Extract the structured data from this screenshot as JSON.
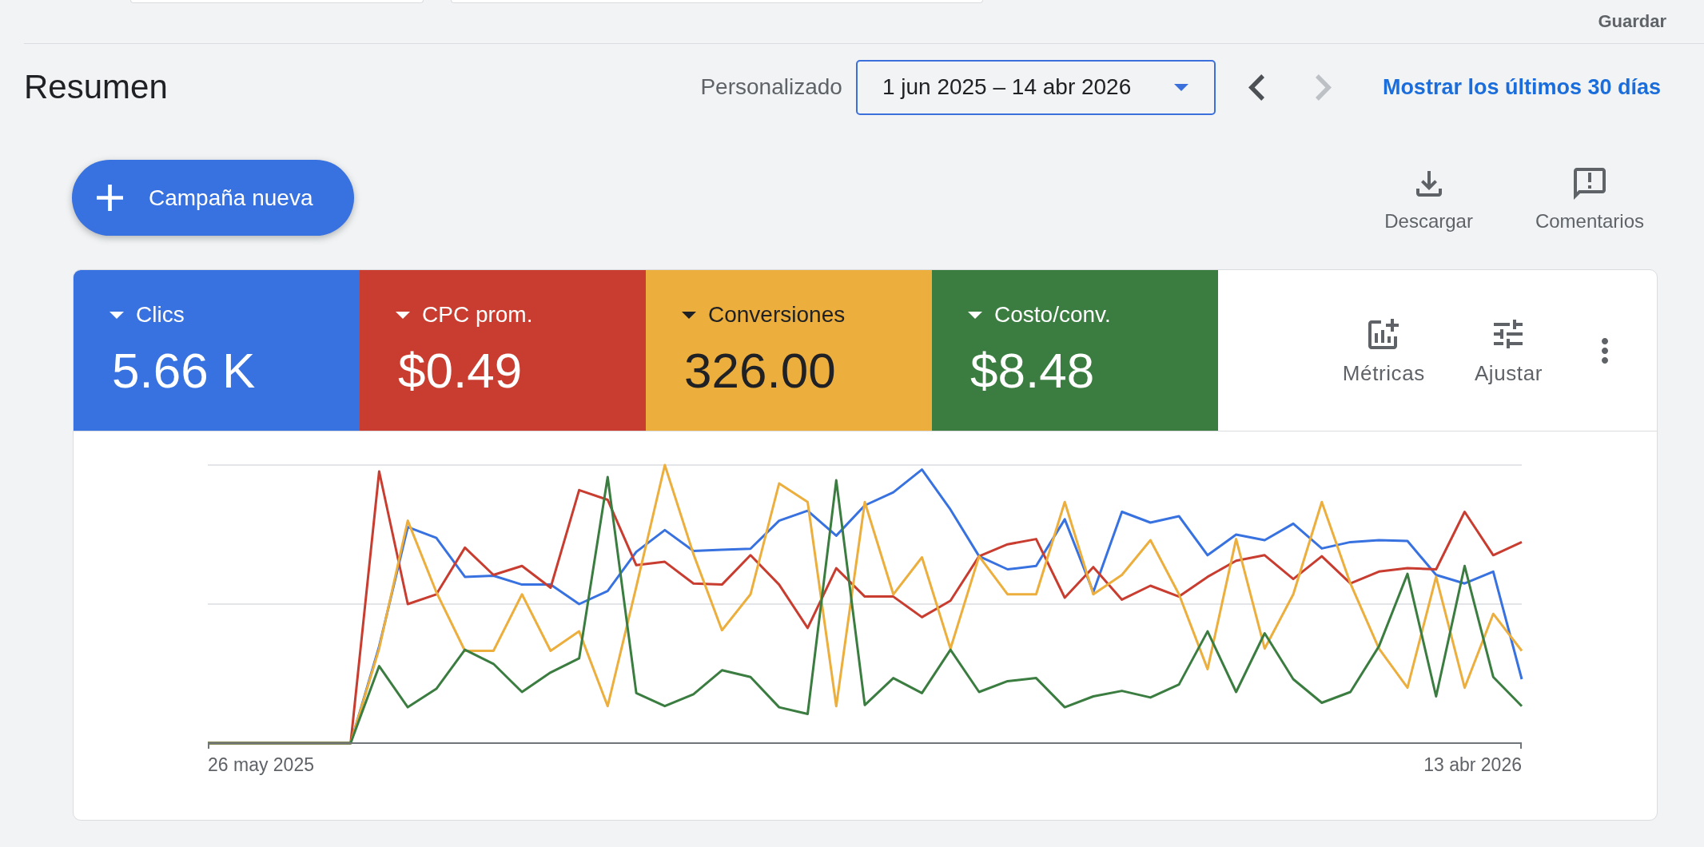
{
  "toolbar": {
    "save_link": "Guardar"
  },
  "header": {
    "title": "Resumen",
    "range_label": "Personalizado",
    "date_range": "1 jun 2025 – 14 abr 2026",
    "previous": {
      "disabled": false
    },
    "next": {
      "disabled": true
    },
    "last_30_days_link": "Mostrar los últimos 30 días"
  },
  "actions": {
    "new_campaign_button": "Campaña nueva",
    "buttons": [
      {
        "kind": "download",
        "label": "Descargar"
      },
      {
        "kind": "feedback",
        "label": "Comentarios"
      }
    ]
  },
  "metrics": [
    {
      "label": "Clics",
      "value": "5.66 K",
      "color": "#3871e0",
      "selected": true
    },
    {
      "label": "CPC prom.",
      "value": "$0.49",
      "color": "#c83d30",
      "selected": true
    },
    {
      "label": "Conversiones",
      "value": "326.00",
      "color": "#ecae3c",
      "selected": true
    },
    {
      "label": "Costo/conv.",
      "value": "$8.48",
      "color": "#3b7d40",
      "selected": true
    }
  ],
  "metric_tools": [
    {
      "kind": "metrics",
      "label": "Métricas"
    },
    {
      "kind": "adjust",
      "label": "Ajustar"
    }
  ],
  "chart": {
    "start_label": "26 may 2025",
    "end_label": "13 abr 2026"
  }
}
